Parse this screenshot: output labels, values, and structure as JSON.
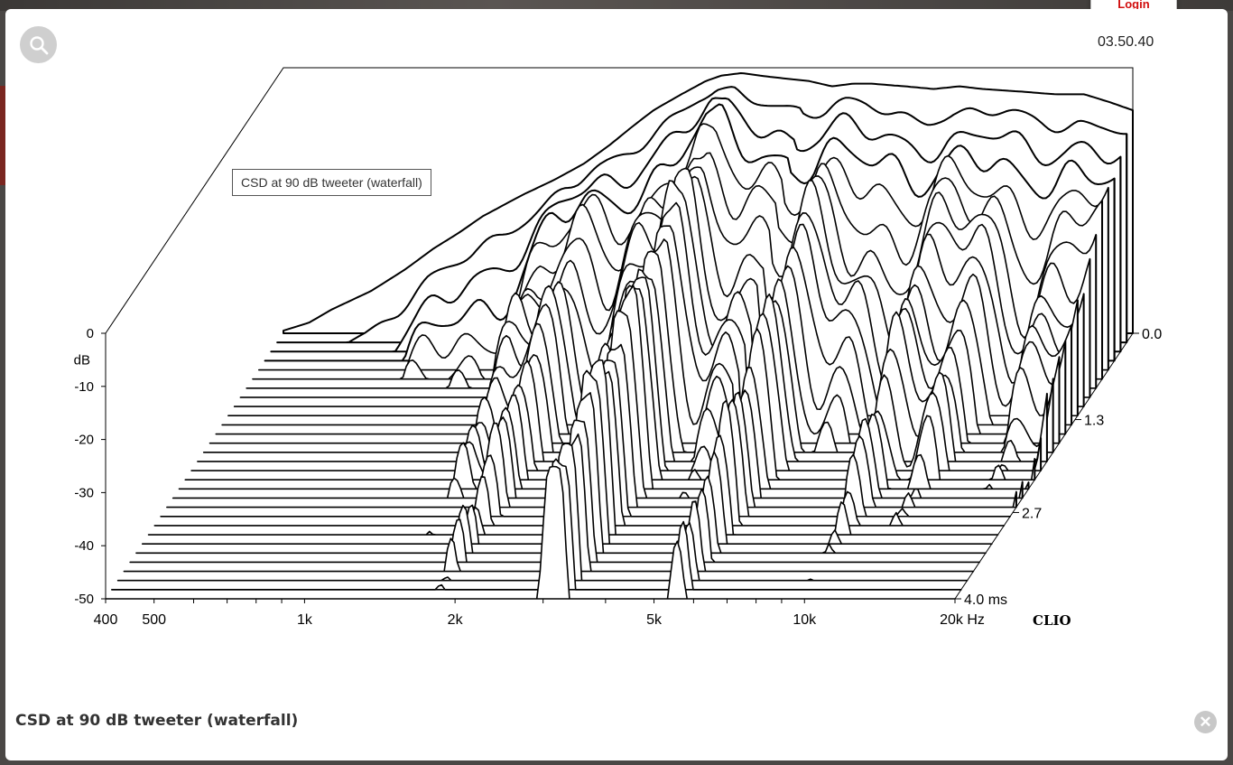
{
  "login_label": "Login",
  "timestamp": "03.50.40",
  "tooltip_text": "CSD at 90 dB tweeter (waterfall)",
  "caption": "CSD at 90 dB tweeter (waterfall)",
  "icons": {
    "zoom": "search-icon",
    "close": "close-icon"
  },
  "colors": {
    "accent_red": "#d10d0d",
    "backdrop": "#4a4745"
  },
  "chart_data": {
    "type": "waterfall",
    "brand": "CLIO",
    "y_unit": "dB",
    "y_ticks": [
      "0",
      "-10",
      "-20",
      "-30",
      "-40",
      "-50"
    ],
    "ylim": [
      -50,
      0
    ],
    "x_ticks": [
      "400",
      "500",
      "1k",
      "2k",
      "5k",
      "10k",
      "20k Hz"
    ],
    "xlim": [
      400,
      20000
    ],
    "x_scale": "log",
    "z_ticks": [
      "0.0",
      "1.3",
      "2.7",
      "4.0 ms"
    ],
    "zlim": [
      0,
      4.0
    ],
    "slice_count": 30,
    "spectrum_db": [
      [
        400,
        -49.5
      ],
      [
        450,
        -48
      ],
      [
        500,
        -45.5
      ],
      [
        600,
        -42
      ],
      [
        700,
        -38
      ],
      [
        800,
        -34
      ],
      [
        900,
        -31
      ],
      [
        1000,
        -28
      ],
      [
        1200,
        -24
      ],
      [
        1400,
        -21
      ],
      [
        1600,
        -18
      ],
      [
        1800,
        -14.5
      ],
      [
        2000,
        -11
      ],
      [
        2200,
        -8
      ],
      [
        2500,
        -5
      ],
      [
        2800,
        -2.5
      ],
      [
        3000,
        -1.5
      ],
      [
        3300,
        -1
      ],
      [
        3600,
        -1.5
      ],
      [
        4000,
        -2
      ],
      [
        4500,
        -2.5
      ],
      [
        5000,
        -3.5
      ],
      [
        5500,
        -3
      ],
      [
        6000,
        -3
      ],
      [
        7000,
        -3.5
      ],
      [
        8000,
        -4
      ],
      [
        9000,
        -3.5
      ],
      [
        10000,
        -4
      ],
      [
        12000,
        -4.5
      ],
      [
        14000,
        -5
      ],
      [
        16000,
        -5
      ],
      [
        18000,
        -6.5
      ],
      [
        20000,
        -8
      ]
    ]
  }
}
